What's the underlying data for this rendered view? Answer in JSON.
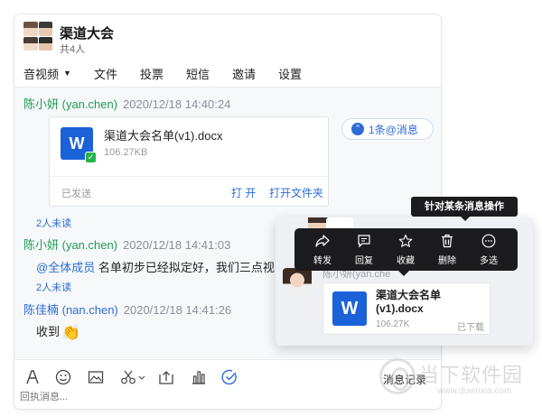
{
  "header": {
    "group_name": "渠道大会",
    "member_count": "共4人"
  },
  "toolbar": {
    "items": [
      {
        "label": "音视频",
        "has_caret": true
      },
      {
        "label": "文件"
      },
      {
        "label": "投票"
      },
      {
        "label": "短信"
      },
      {
        "label": "邀请"
      },
      {
        "label": "设置"
      }
    ]
  },
  "messages": [
    {
      "sender": "陈小妍 (yan.chen)",
      "time": "2020/12/18 14:40:24",
      "file": {
        "icon": "word-document-icon",
        "name": "渠道大会名单(v1).docx",
        "size": "106.27KB",
        "status": "已发送",
        "open_label": "打 开",
        "open_folder_label": "打开文件夹"
      },
      "unread": "2人未读"
    },
    {
      "sender": "陈小妍 (yan.chen)",
      "time": "2020/12/18 14:41:03",
      "mention": "@全体成员",
      "text": " 名单初步已经拟定好，我们三点视",
      "unread": "2人未读"
    },
    {
      "sender": "陈佳楠 (nan.chen)",
      "time": "2020/12/18 14:41:26",
      "text": "收到",
      "emoji": "clap-icon"
    }
  ],
  "reply_pill": {
    "label": "1条@消息",
    "icon": "chevron-up-icon"
  },
  "input_bar": {
    "tools": [
      "font-icon",
      "emoji-icon",
      "image-icon",
      "scissors-icon",
      "upload-icon",
      "chart-icon",
      "check-circle-icon"
    ],
    "history_label": "消息记录",
    "placeholder": "回执消息..."
  },
  "callout": {
    "tooltip": "针对某条消息操作",
    "actions": [
      {
        "label": "转发",
        "icon": "forward-icon"
      },
      {
        "label": "回复",
        "icon": "reply-icon"
      },
      {
        "label": "收藏",
        "icon": "star-icon"
      },
      {
        "label": "删除",
        "icon": "trash-icon"
      },
      {
        "label": "多选",
        "icon": "more-icon"
      }
    ],
    "sender": "陈小妍(yan.che",
    "file": {
      "name": "渠道大会名单(v1).docx",
      "size": "106.27K",
      "status": "已下载"
    }
  },
  "watermark": {
    "text": "当下软件园",
    "url": "www.downxia.com"
  },
  "colors": {
    "accent": "#2c6bd6",
    "sender_green": "#1f9b55",
    "word_blue": "#1b62d8",
    "menu_bg": "#1c1c1e"
  }
}
